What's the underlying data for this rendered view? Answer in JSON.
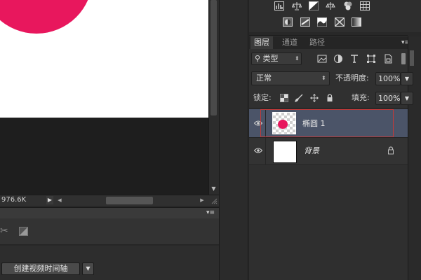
{
  "status_bar": {
    "zoom_readout": "976.6K"
  },
  "timeline": {
    "create_video_label": "创建视频时间轴"
  },
  "layers_panel": {
    "tabs": [
      {
        "label": "图层",
        "active": true
      },
      {
        "label": "通道",
        "active": false
      },
      {
        "label": "路径",
        "active": false
      }
    ],
    "filter": {
      "value": "类型"
    },
    "blend_mode": "正常",
    "opacity_label": "不透明度:",
    "opacity_value": "100%",
    "lock_label": "锁定:",
    "fill_label": "填充:",
    "fill_value": "100%",
    "layers": [
      {
        "name": "椭圆 1",
        "selected": true,
        "visible": true
      },
      {
        "name": "背景",
        "selected": false,
        "visible": true,
        "locked": true
      }
    ]
  },
  "colors": {
    "accent_red": "#e8175d",
    "selected_layer_bg": "#4b5468",
    "selection_outline": "#c23a3a"
  }
}
